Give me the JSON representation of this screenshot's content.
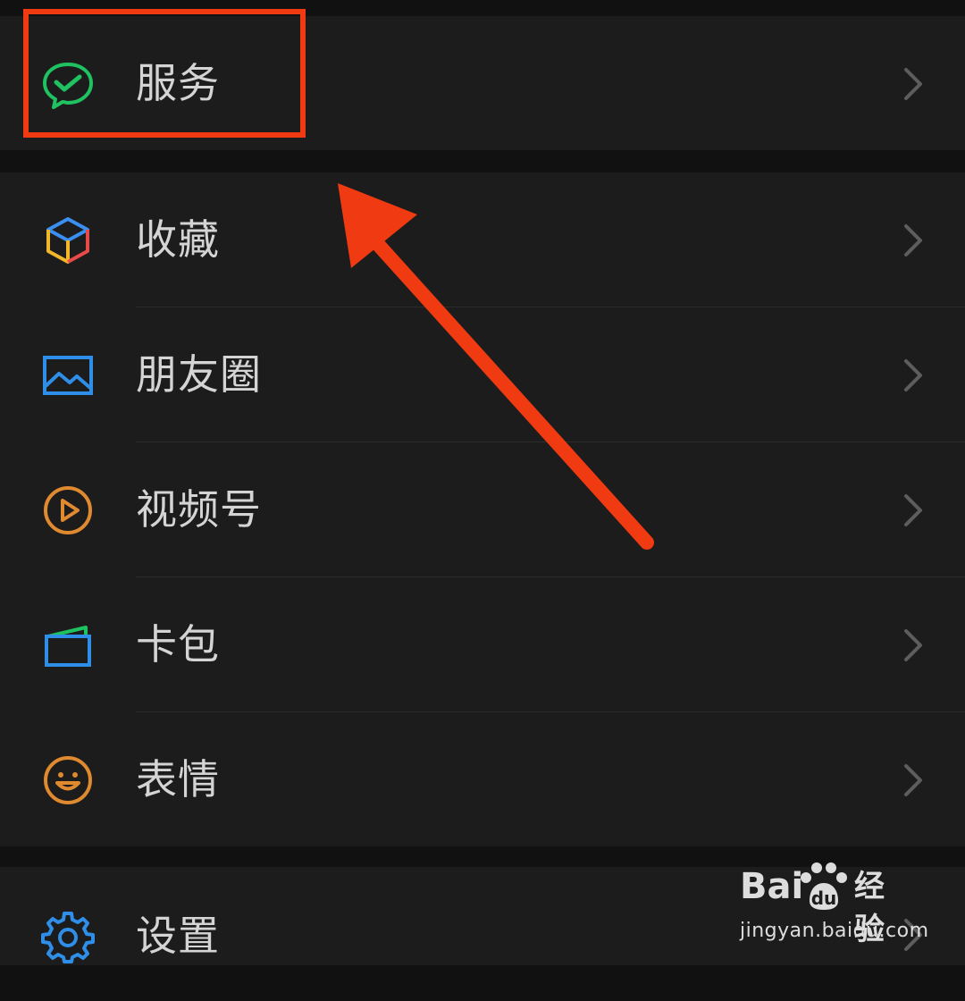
{
  "menu": {
    "items": [
      {
        "label": "服务",
        "icon": "wechat-pay-icon"
      },
      {
        "label": "收藏",
        "icon": "favorites-cube-icon"
      },
      {
        "label": "朋友圈",
        "icon": "moments-image-icon"
      },
      {
        "label": "视频号",
        "icon": "channels-play-icon"
      },
      {
        "label": "卡包",
        "icon": "card-wallet-icon"
      },
      {
        "label": "表情",
        "icon": "sticker-smiley-icon"
      },
      {
        "label": "设置",
        "icon": "settings-gear-icon"
      }
    ]
  },
  "annotation": {
    "color": "#f03a12",
    "highlighted_item": "服务"
  },
  "watermark": {
    "brand_left": "Bai",
    "brand_mid": "du",
    "brand_right": "经验",
    "url": "jingyan.baidu.com"
  },
  "colors": {
    "background": "#111111",
    "row": "#1c1c1c",
    "text": "#d4d4d4",
    "chevron": "#5d5d5d"
  }
}
